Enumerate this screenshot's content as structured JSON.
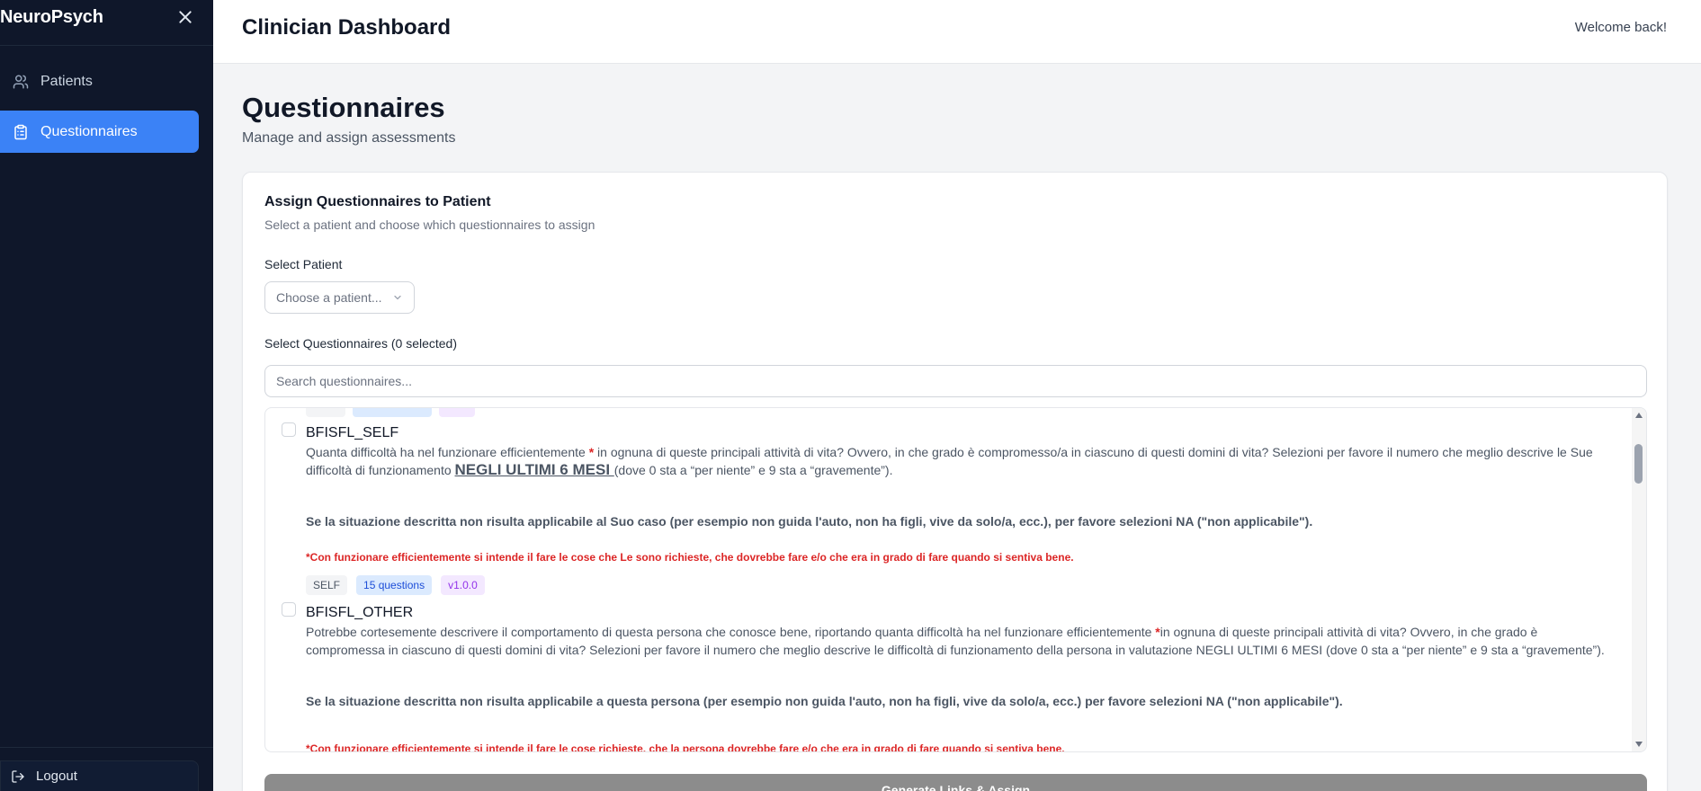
{
  "sidebar": {
    "brand": "NeuroPsych",
    "items": [
      {
        "label": "Patients",
        "icon": "users-icon",
        "active": false
      },
      {
        "label": "Questionnaires",
        "icon": "clipboard-list-icon",
        "active": true
      }
    ],
    "logout_label": "Logout"
  },
  "header": {
    "title": "Clinician Dashboard",
    "welcome": "Welcome back!"
  },
  "page": {
    "title": "Questionnaires",
    "subtitle": "Manage and assign assessments"
  },
  "card": {
    "title": "Assign Questionnaires to Patient",
    "description": "Select a patient and choose which questionnaires to assign",
    "patient_label": "Select Patient",
    "patient_placeholder": "Choose a patient...",
    "questionnaires_label": "Select Questionnaires (0 selected)",
    "search_placeholder": "Search questionnaires...",
    "generate_label": "Generate Links & Assign"
  },
  "questionnaires": [
    {
      "name": "BFISFL_SELF",
      "desc_part1": "Quanta difficoltà ha nel funzionare efficientemente ",
      "star": "*",
      "desc_part2": " in ognuna di queste principali attività di vita? Ovvero, in che grado è compromesso/a in ciascuno di questi domini di vita? Selezioni per favore il numero che meglio descrive le Sue difficoltà di funzionamento ",
      "desc_emph": "NEGLI ULTIMI 6 MESI ",
      "desc_part3": "(dove 0 sta a “per niente” e 9 sta a “gravemente”).",
      "bold_note": "Se la situazione descritta non risulta applicabile al Suo caso (per esempio non guida l'auto, non ha figli, vive da solo/a, ecc.), per favore selezioni NA (\"non applicabile\").",
      "red_note": "*Con funzionare efficientemente si intende il fare le cose che Le sono richieste, che dovrebbe fare e/o che era in grado di fare quando si sentiva bene.",
      "tags": {
        "type": "SELF",
        "count": "15 questions",
        "version": "v1.0.0"
      }
    },
    {
      "name": "BFISFL_OTHER",
      "desc_part1": "Potrebbe cortesemente descrivere il comportamento di questa persona che conosce bene, riportando quanta difficoltà ha nel funzionare efficientemente ",
      "star": "*",
      "desc_part2": "in ognuna di queste principali attività di vita? Ovvero, in che grado è compromessa in ciascuno di questi domini di vita? Selezioni per favore il numero che meglio descrive le difficoltà di funzionamento della persona in valutazione NEGLI ULTIMI 6 MESI (dove 0 sta a “per niente” e 9 sta a “gravemente”).",
      "bold_note": "Se la situazione descritta non risulta applicabile a questa persona (per esempio non guida l'auto, non ha figli, vive da solo/a, ecc.) per favore selezioni NA (\"non applicabile\").",
      "red_note": "*Con funzionare efficientemente si intende il fare le cose richieste, che la persona dovrebbe fare e/o che era in grado di fare quando si sentiva bene."
    }
  ],
  "colors": {
    "sidebar_bg": "#0f172a",
    "accent": "#3b82f6",
    "danger": "#dc2626",
    "disabled_button": "#8c8c8c"
  }
}
